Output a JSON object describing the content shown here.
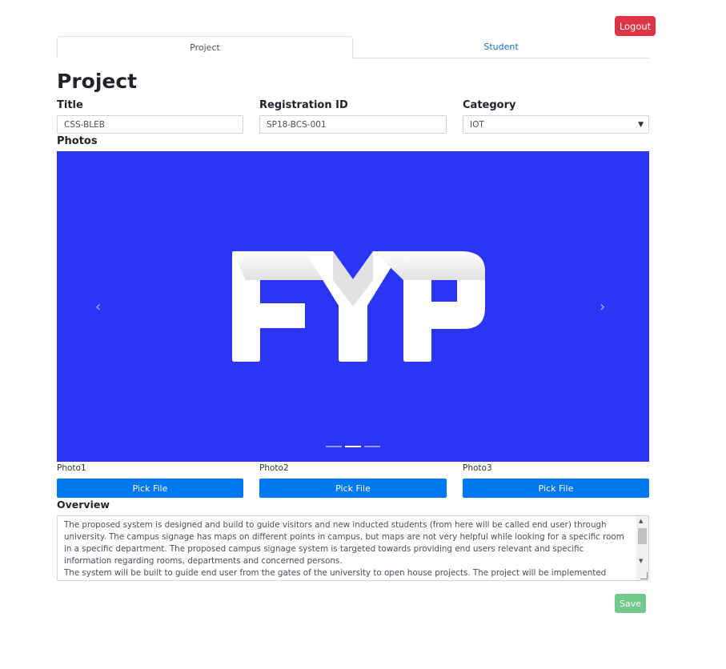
{
  "header": {
    "logout_label": "Logout"
  },
  "tabs": [
    {
      "label": "Project",
      "active": true
    },
    {
      "label": "Student",
      "active": false
    }
  ],
  "page_title": "Project",
  "form": {
    "title": {
      "label": "Title",
      "value": "CSS-BLEB"
    },
    "registration": {
      "label": "Registration ID",
      "value": "SP18-BCS-001"
    },
    "category": {
      "label": "Category",
      "value": "IOT"
    },
    "photos_label": "Photos"
  },
  "carousel": {
    "logo_text": "FYP",
    "background_color": "#2a35f5",
    "indicator_count": 3,
    "active_index": 1,
    "prev_icon": "chevron-left-icon",
    "next_icon": "chevron-right-icon"
  },
  "photos": [
    {
      "label": "Photo1",
      "button": "Pick File"
    },
    {
      "label": "Photo2",
      "button": "Pick File"
    },
    {
      "label": "Photo3",
      "button": "Pick File"
    }
  ],
  "overview": {
    "label": "Overview",
    "text": "The proposed system is designed and build to guide visitors and new inducted students (from here will be called end user) through university. The campus signage has maps on different points in campus, but maps are not very helpful while looking for a specific room in a specific department. The proposed campus signage system is targeted towards providing end users relevant and specific information regarding rooms, departments and concerned persons.\nThe system will be built to guide end user from the gates of the university to open house projects. The project will be implemented using Bluetooth"
  },
  "footer": {
    "save_label": "Save"
  },
  "colors": {
    "danger": "#dc3545",
    "primary": "#0078ef",
    "success": "#72c98c",
    "link": "#1b6ec2"
  }
}
